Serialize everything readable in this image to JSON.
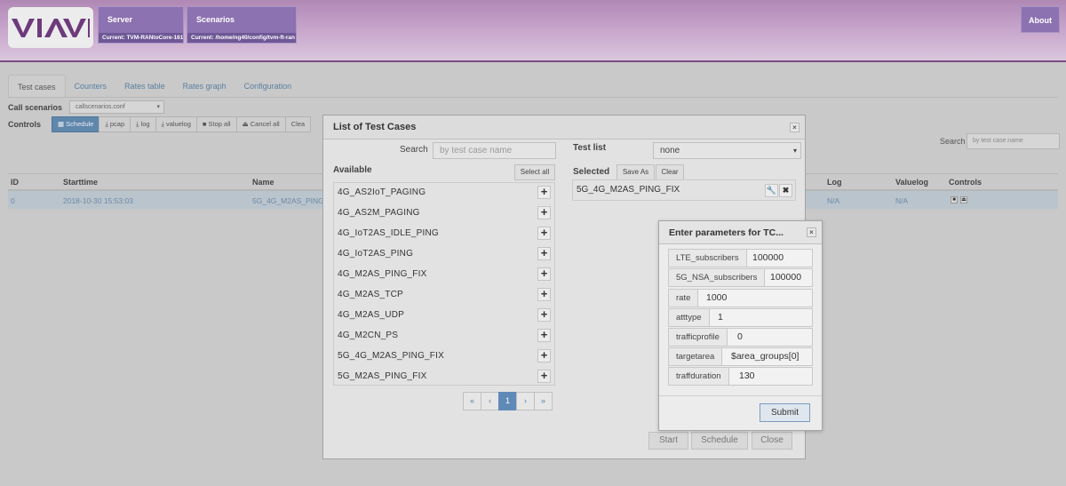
{
  "header": {
    "logo_text": "VIAVI",
    "server": {
      "title": "Server",
      "current": "Current: TVM-RANtoCore-161"
    },
    "scenarios": {
      "title": "Scenarios",
      "current": "Current: /home/ng40/config/tvm-ft-ran"
    },
    "about": "About"
  },
  "tabs": [
    "Test cases",
    "Counters",
    "Rates table",
    "Rates graph",
    "Configuration"
  ],
  "call_scenarios": {
    "label": "Call scenarios",
    "value": "callscenarios.conf"
  },
  "controls": {
    "label": "Controls",
    "buttons": [
      "Schedule",
      "pcap",
      "log",
      "valuelog",
      "Stop all",
      "Cancel all",
      "Clea"
    ]
  },
  "search": {
    "label": "Search",
    "placeholder": "by test case name"
  },
  "table": {
    "headers": {
      "id": "ID",
      "starttime": "Starttime",
      "name": "Name",
      "log": "Log",
      "valuelog": "Valuelog",
      "controls": "Controls"
    },
    "row": {
      "id": "0",
      "starttime": "2018-10-30 15:53:03",
      "name": "5G_4G_M2AS_PING",
      "log": "N/A",
      "valuelog": "N/A"
    }
  },
  "test_cases_modal": {
    "title": "List of Test Cases",
    "search_label": "Search",
    "search_placeholder": "by test case name",
    "test_list_label": "Test list",
    "test_list_value": "none",
    "available_label": "Available",
    "select_all": "Select all",
    "selected_label": "Selected",
    "save_as": "Save As",
    "clear": "Clear",
    "available": [
      "4G_AS2IoT_PAGING",
      "4G_AS2M_PAGING",
      "4G_IoT2AS_IDLE_PING",
      "4G_IoT2AS_PING",
      "4G_M2AS_PING_FIX",
      "4G_M2AS_TCP",
      "4G_M2AS_UDP",
      "4G_M2CN_PS",
      "5G_4G_M2AS_PING_FIX",
      "5G_M2AS_PING_FIX"
    ],
    "selected": [
      "5G_4G_M2AS_PING_FIX"
    ],
    "pager": [
      "«",
      "‹",
      "1",
      "›",
      "»"
    ],
    "footer": {
      "start": "Start",
      "schedule": "Schedule",
      "close": "Close"
    }
  },
  "params_modal": {
    "title": "Enter parameters for TC...",
    "params": [
      {
        "key": "LTE_subscribers",
        "value": "100000"
      },
      {
        "key": "5G_NSA_subscribers",
        "value": "100000"
      },
      {
        "key": "rate",
        "value": "1000"
      },
      {
        "key": "atttype",
        "value": "1"
      },
      {
        "key": "trafficprofile",
        "value": "0"
      },
      {
        "key": "targetarea",
        "value": "$area_groups[0]"
      },
      {
        "key": "traffduration",
        "value": "130"
      }
    ],
    "submit": "Submit"
  },
  "colors": {
    "brand": "#8c72b0",
    "primary_button": "#5f86ab",
    "page_overlay": "#c9c9c9"
  }
}
